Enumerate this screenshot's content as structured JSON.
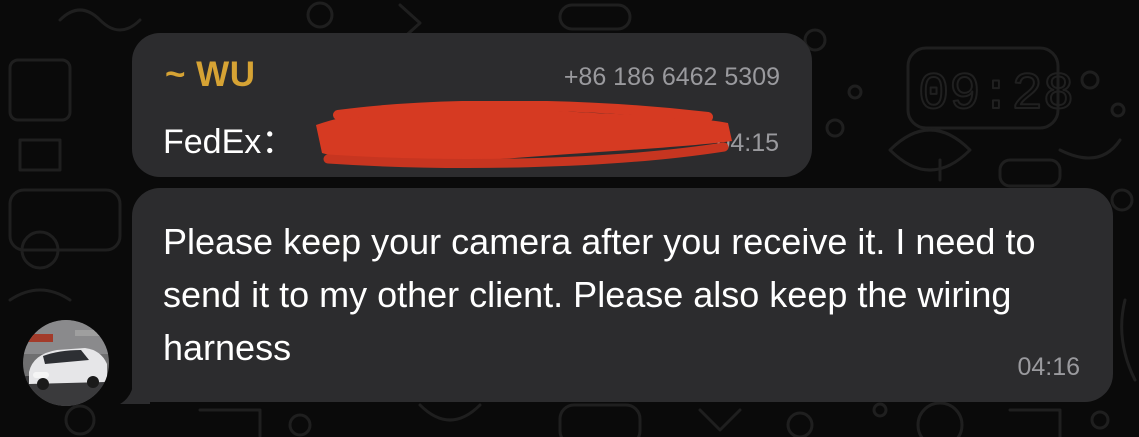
{
  "messages": [
    {
      "sender": "~ WU",
      "phone": "+86 186 6462 5309",
      "text": "FedEx：",
      "time": "04:15",
      "redacted": true
    },
    {
      "text": "Please keep your camera after you receive it. I need to send it to my other client. Please also keep the wiring harness",
      "time": "04:16"
    }
  ],
  "avatar": {
    "icon": "car-photo-avatar"
  },
  "colors": {
    "background": "#0a0a0a",
    "bubble": "#2c2c2e",
    "sender": "#d6a334",
    "meta": "#9a9a9e",
    "redaction": "#d63a22"
  }
}
